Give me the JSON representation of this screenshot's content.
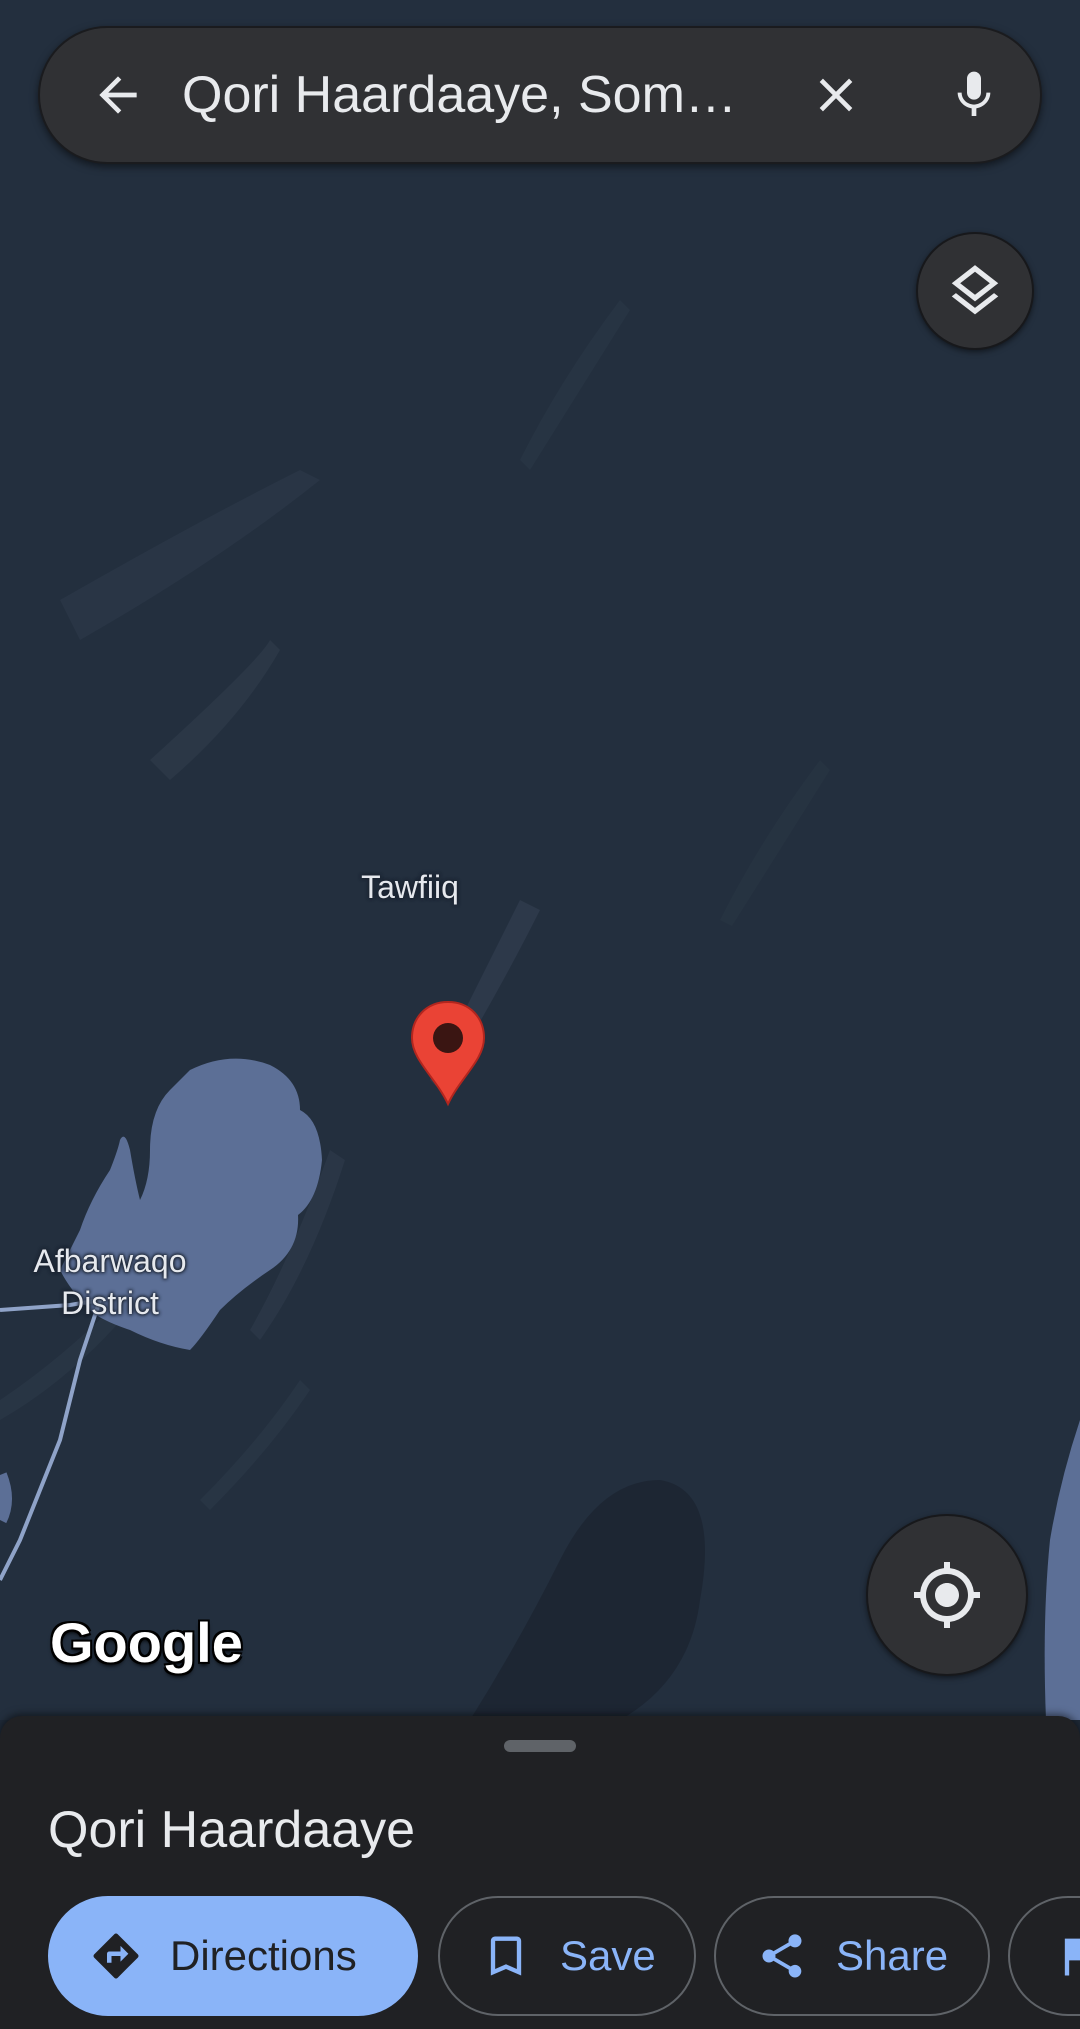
{
  "search": {
    "query": "Qori Haardaaye, Som…"
  },
  "map": {
    "labels": {
      "tawfiiq": "Tawfiiq",
      "district_line1": "Afbarwaqo",
      "district_line2": "District"
    },
    "logo_text": "Google",
    "pin_color": "#ea4335"
  },
  "sheet": {
    "title": "Qori Haardaaye",
    "actions": {
      "directions": "Directions",
      "save": "Save",
      "share": "Share"
    }
  },
  "colors": {
    "accent": "#8ab4f8",
    "water": "#5c6f96",
    "surface": "#303134",
    "sheet": "#202124"
  },
  "icons": {
    "back": "arrow-back-icon",
    "clear": "close-icon",
    "mic": "microphone-icon",
    "layers": "layers-icon",
    "locate": "my-location-icon",
    "directions": "directions-icon",
    "save": "bookmark-icon",
    "share": "share-icon",
    "more": "flag-icon"
  }
}
